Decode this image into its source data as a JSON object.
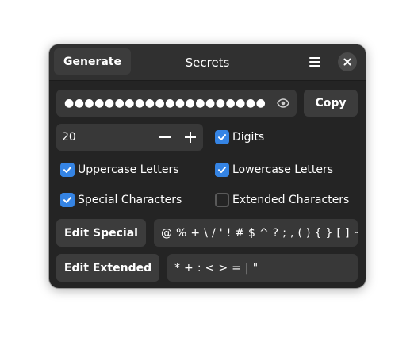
{
  "header": {
    "generate_label": "Generate",
    "title": "Secrets",
    "menu_icon": "hamburger-menu-icon",
    "close_icon": "close-icon"
  },
  "password": {
    "value": "●●●●●●●●●●●●●●●●●●●●",
    "reveal_icon": "eye-icon",
    "copy_label": "Copy"
  },
  "length": {
    "value": "20",
    "decrement_icon": "minus-icon",
    "increment_icon": "plus-icon"
  },
  "options": {
    "digits": {
      "label": "Digits",
      "checked": true
    },
    "uppercase": {
      "label": "Uppercase Letters",
      "checked": true
    },
    "lowercase": {
      "label": "Lowercase Letters",
      "checked": true
    },
    "special": {
      "label": "Special Characters",
      "checked": true
    },
    "extended": {
      "label": "Extended Characters",
      "checked": false
    }
  },
  "special_chars": {
    "button_label": "Edit Special",
    "value": "@ % + \\ / ' ! # $ ^ ? ; , ( ) { } [ ] ~ ` - _ ."
  },
  "extended_chars": {
    "button_label": "Edit Extended",
    "value": "* + : < > = | \""
  },
  "colors": {
    "window_bg": "#242424",
    "headerbar_bg": "#303030",
    "button_bg": "#3c3c3c",
    "entry_bg": "#383838",
    "accent": "#3584e4"
  }
}
